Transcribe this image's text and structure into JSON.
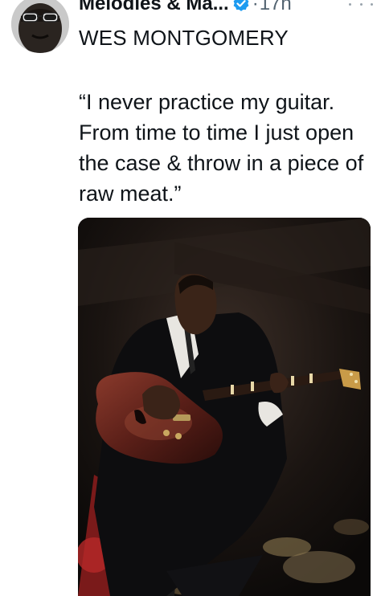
{
  "tweet": {
    "author": {
      "display_name": "Melodies & Ma...",
      "verified": true,
      "verified_badge_color": "#1d9bf0",
      "avatar_icon": "avatar-photo"
    },
    "separator": "·",
    "timestamp": "17h",
    "more_icon": "more-dots-icon",
    "text_lines": [
      "WES MONTGOMERY",
      "“I never practice my guitar. From time to time I just open the case & throw in a piece of raw meat.”"
    ],
    "media": {
      "type": "photo",
      "description_icon": "guitarist-photo"
    }
  },
  "colors": {
    "text_primary": "#0f1419",
    "text_secondary": "#536471",
    "accent": "#1d9bf0"
  }
}
